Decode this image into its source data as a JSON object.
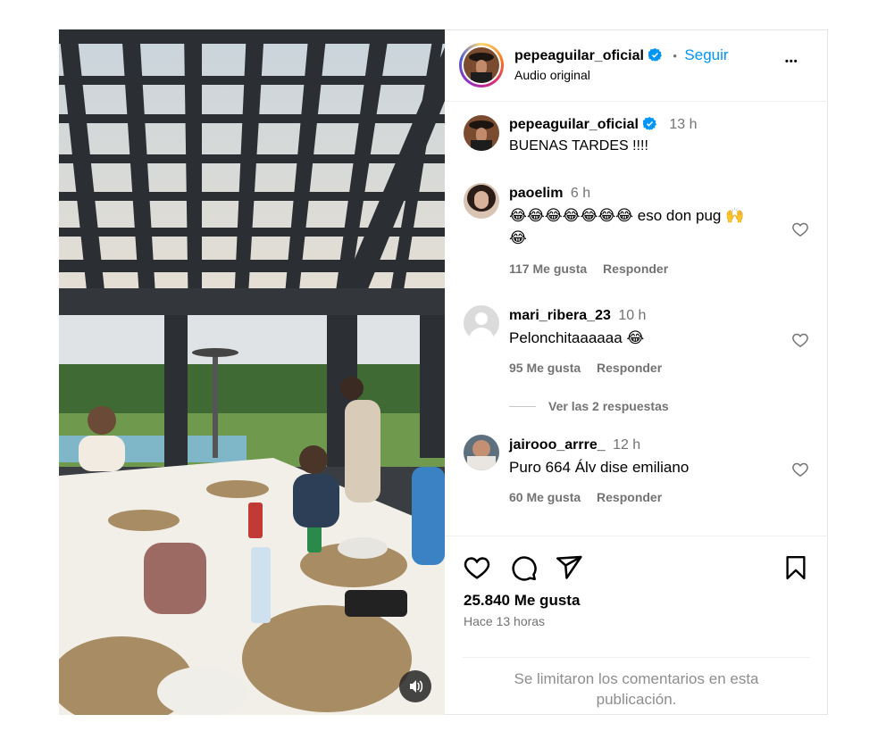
{
  "header": {
    "username": "pepeaguilar_oficial",
    "dot": "•",
    "follow_label": "Seguir",
    "subtitle": "Audio original",
    "more_label": "•••"
  },
  "caption": {
    "username": "pepeaguilar_oficial",
    "time": "13 h",
    "text": "BUENAS TARDES !!!!"
  },
  "comments": [
    {
      "username": "paoelim",
      "time": "6 h",
      "text_line1": "😂😂😂😂😂😂😂 eso don pug 🙌",
      "text_line2": "😂",
      "likes": "117 Me gusta",
      "reply": "Responder"
    },
    {
      "username": "mari_ribera_23",
      "time": "10 h",
      "text_line1": "Pelonchitaaaaaa 😂",
      "likes": "95 Me gusta",
      "reply": "Responder",
      "view_replies": "Ver las 2 respuestas"
    },
    {
      "username": "jairooo_arrre_",
      "time": "12 h",
      "text_line1": "Puro 664 Álv dise emiliano",
      "likes": "60 Me gusta",
      "reply": "Responder"
    }
  ],
  "actions": {
    "likes_count": "25.840 Me gusta",
    "time_ago": "Hace 13 horas"
  },
  "footer": {
    "limited_line1": "Se limitaron los comentarios en esta",
    "limited_line2": "publicación."
  },
  "colors": {
    "accent": "#0095f6",
    "verified": "#0095f6",
    "muted": "#737373"
  },
  "icons": [
    "verified-badge-icon",
    "more-options-icon",
    "heart-icon",
    "comment-icon",
    "share-icon",
    "bookmark-icon",
    "speaker-icon"
  ]
}
